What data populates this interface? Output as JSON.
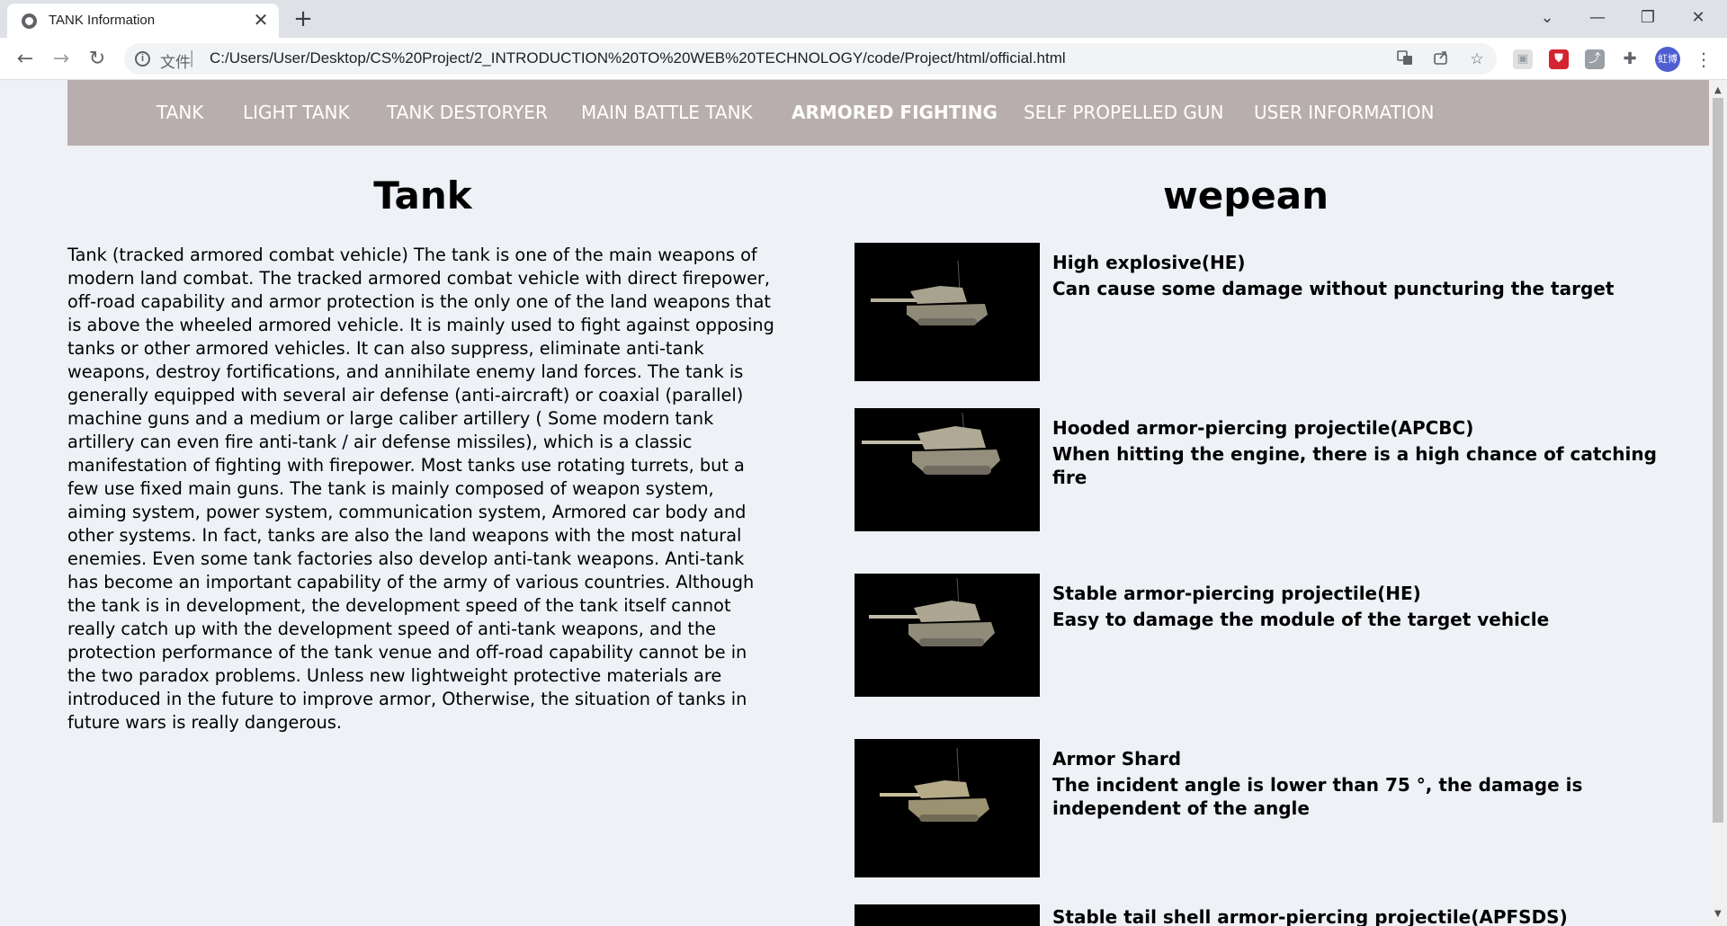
{
  "browser": {
    "tab_title": "TANK Information",
    "tab_close": "✕",
    "new_tab": "+",
    "window_controls": [
      "⌄",
      "—",
      "❐",
      "✕"
    ],
    "url_scheme_label": "文件",
    "url_separator": "|",
    "url": "C:/Users/User/Desktop/CS%20Project/2_INTRODUCTION%20TO%20WEB%20TECHNOLOGY/code/Project/html/official.html",
    "nav": {
      "back": "←",
      "forward": "→",
      "reload": "↻"
    },
    "omnibox_icons": [
      "translate-icon",
      "share-icon",
      "star-icon"
    ],
    "extensions": [
      "reader-icon",
      "shield-extension-icon",
      "pdf-extension-icon",
      "puzzle-icon"
    ],
    "profile_label": "虹博",
    "menu": "⋮"
  },
  "site_nav": {
    "items": [
      "TANK",
      "LIGHT TANK",
      "TANK DESTORYER",
      "MAIN BATTLE TANK",
      "ARMORED FIGHTING",
      "SELF PROPELLED GUN",
      "USER INFORMATION"
    ],
    "active": "ARMORED FIGHTING",
    "background": "#b9aeae"
  },
  "left": {
    "title": "Tank",
    "body": "Tank (tracked armored combat vehicle) The tank is one of the main weapons of modern land combat. The tracked armored combat vehicle with direct firepower, off-road capability and armor protection is the only one of the land weapons that is above the wheeled armored vehicle. It is mainly used to fight against opposing tanks or other armored vehicles. It can also suppress, eliminate anti-tank weapons, destroy fortifications, and annihilate enemy land forces. The tank is generally equipped with several air defense (anti-aircraft) or coaxial (parallel) machine guns and a medium or large caliber artillery ( Some modern tank artillery can even fire anti-tank / air defense missiles), which is a classic manifestation of fighting with firepower. Most tanks use rotating turrets, but a few use fixed main guns. The tank is mainly composed of weapon system, aiming system, power system, communication system, Armored car body and other systems. In fact, tanks are also the land weapons with the most natural enemies. Even some tank factories also develop anti-tank weapons. Anti-tank has become an important capability of the army of various countries. Although the tank is in development, the development speed of the tank itself cannot really catch up with the development speed of anti-tank weapons, and the protection performance of the tank venue and off-road capability cannot be in the two paradox problems. Unless new lightweight protective materials are introduced in the future to improve armor, Otherwise, the situation of tanks in future wars is really dangerous."
  },
  "right": {
    "title": "wepean",
    "weapons": [
      {
        "name": "High explosive(HE)",
        "desc": "Can cause some damage without puncturing the target"
      },
      {
        "name": "Hooded armor-piercing projectile(APCBC)",
        "desc": "When hitting the engine, there is a high chance of catching fire"
      },
      {
        "name": "Stable armor-piercing projectile(HE)",
        "desc": "Easy to damage the module of the target vehicle"
      },
      {
        "name": "Armor Shard",
        "desc": "The incident angle is lower than 75 °, the damage is independent of the angle"
      },
      {
        "name": "Stable tail shell armor-piercing projectile(APFSDS)",
        "desc": ""
      }
    ]
  },
  "scrollbar": {
    "up": "▲",
    "down": "▼"
  }
}
